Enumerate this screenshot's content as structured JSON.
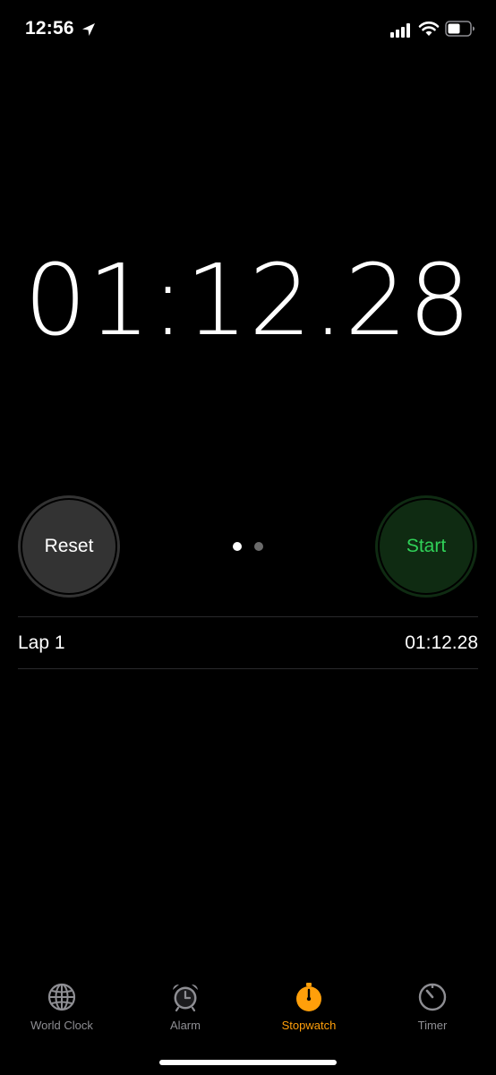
{
  "status_bar": {
    "time": "12:56",
    "icons": [
      "location-arrow-icon",
      "cellular-signal-icon",
      "wifi-icon",
      "battery-icon"
    ]
  },
  "stopwatch": {
    "elapsed": "01:12.28",
    "reset_label": "Reset",
    "start_label": "Start",
    "page_count": 2,
    "current_page": 1
  },
  "laps": [
    {
      "label": "Lap 1",
      "time": "01:12.28"
    }
  ],
  "tab_bar": {
    "tabs": [
      {
        "label": "World Clock",
        "icon": "globe-icon",
        "active": false
      },
      {
        "label": "Alarm",
        "icon": "alarm-clock-icon",
        "active": false
      },
      {
        "label": "Stopwatch",
        "icon": "stopwatch-icon",
        "active": true
      },
      {
        "label": "Timer",
        "icon": "timer-icon",
        "active": false
      }
    ]
  },
  "colors": {
    "background": "#000000",
    "start_green": "#30d158",
    "start_bg": "#0f2b12",
    "reset_bg": "#333333",
    "accent_orange": "#ff9f0a",
    "inactive_gray": "#8e8e93"
  }
}
